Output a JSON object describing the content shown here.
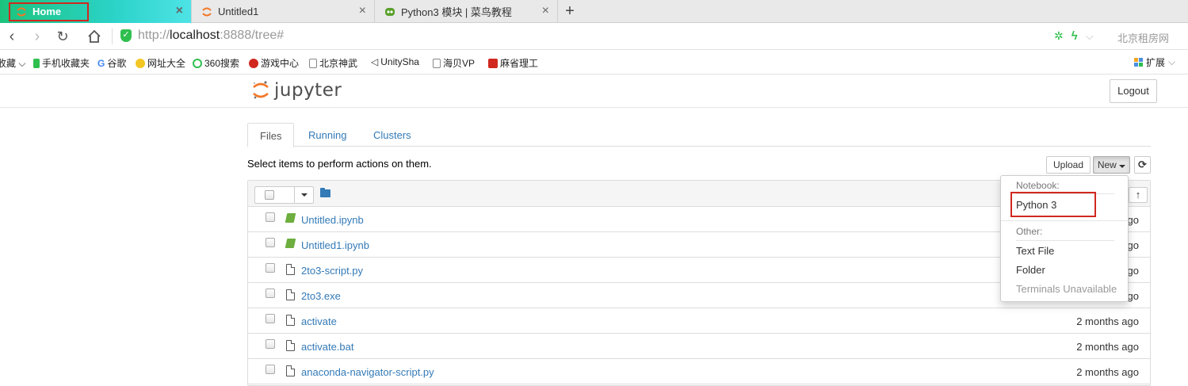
{
  "browser": {
    "tabs": [
      {
        "title": "Home",
        "active": true
      },
      {
        "title": "Untitled1",
        "active": false
      },
      {
        "title": "Python3 模块 | 菜鸟教程",
        "active": false
      }
    ],
    "new_tab_label": "+",
    "url_prefix": "http://",
    "url_host": "localhost",
    "url_rest": ":8888/tree#",
    "right_text": "北京租房网"
  },
  "bookmarks": [
    {
      "label": "收藏 ⌵",
      "icon": "bookmark-icon"
    },
    {
      "label": "手机收藏夹",
      "icon": "phone-icon"
    },
    {
      "label": "谷歌",
      "icon": "google-icon"
    },
    {
      "label": "网址大全",
      "icon": "web-directory-icon"
    },
    {
      "label": "360搜索",
      "icon": "360-search-icon"
    },
    {
      "label": "游戏中心",
      "icon": "game-center-icon"
    },
    {
      "label": "北京神武",
      "icon": "page-icon"
    },
    {
      "label": "UnitySha",
      "icon": "unity-icon"
    },
    {
      "label": "海贝VP",
      "icon": "page-icon"
    },
    {
      "label": "麻省理工",
      "icon": "mit-icon"
    }
  ],
  "extensions_label": "扩展",
  "jupyter": {
    "logo_text": "jupyter",
    "logout_label": "Logout",
    "tabs": [
      "Files",
      "Running",
      "Clusters"
    ],
    "hint": "Select items to perform actions on them.",
    "upload_label": "Upload",
    "new_label": "New",
    "files": [
      {
        "name": "Untitled.ipynb",
        "type": "notebook",
        "modified": ""
      },
      {
        "name": "Untitled1.ipynb",
        "type": "notebook",
        "modified": ""
      },
      {
        "name": "2to3-script.py",
        "type": "file",
        "modified": ""
      },
      {
        "name": "2to3.exe",
        "type": "file",
        "modified": ""
      },
      {
        "name": "activate",
        "type": "file",
        "modified": "2 months ago"
      },
      {
        "name": "activate.bat",
        "type": "file",
        "modified": "2 months ago"
      },
      {
        "name": "anaconda-navigator-script.py",
        "type": "file",
        "modified": "2 months ago"
      }
    ],
    "partial_date_suffix": "ago",
    "new_menu": {
      "notebook_header": "Notebook:",
      "notebook_items": [
        "Python 3"
      ],
      "other_header": "Other:",
      "other_items": [
        {
          "label": "Text File",
          "disabled": false
        },
        {
          "label": "Folder",
          "disabled": false
        },
        {
          "label": "Terminals Unavailable",
          "disabled": true
        }
      ]
    }
  },
  "colors": {
    "highlight_box": "#d0281f",
    "link": "#337ab7",
    "active_tab_gradient_start": "#1bc47d",
    "notebook_icon": "#6dae3e"
  }
}
